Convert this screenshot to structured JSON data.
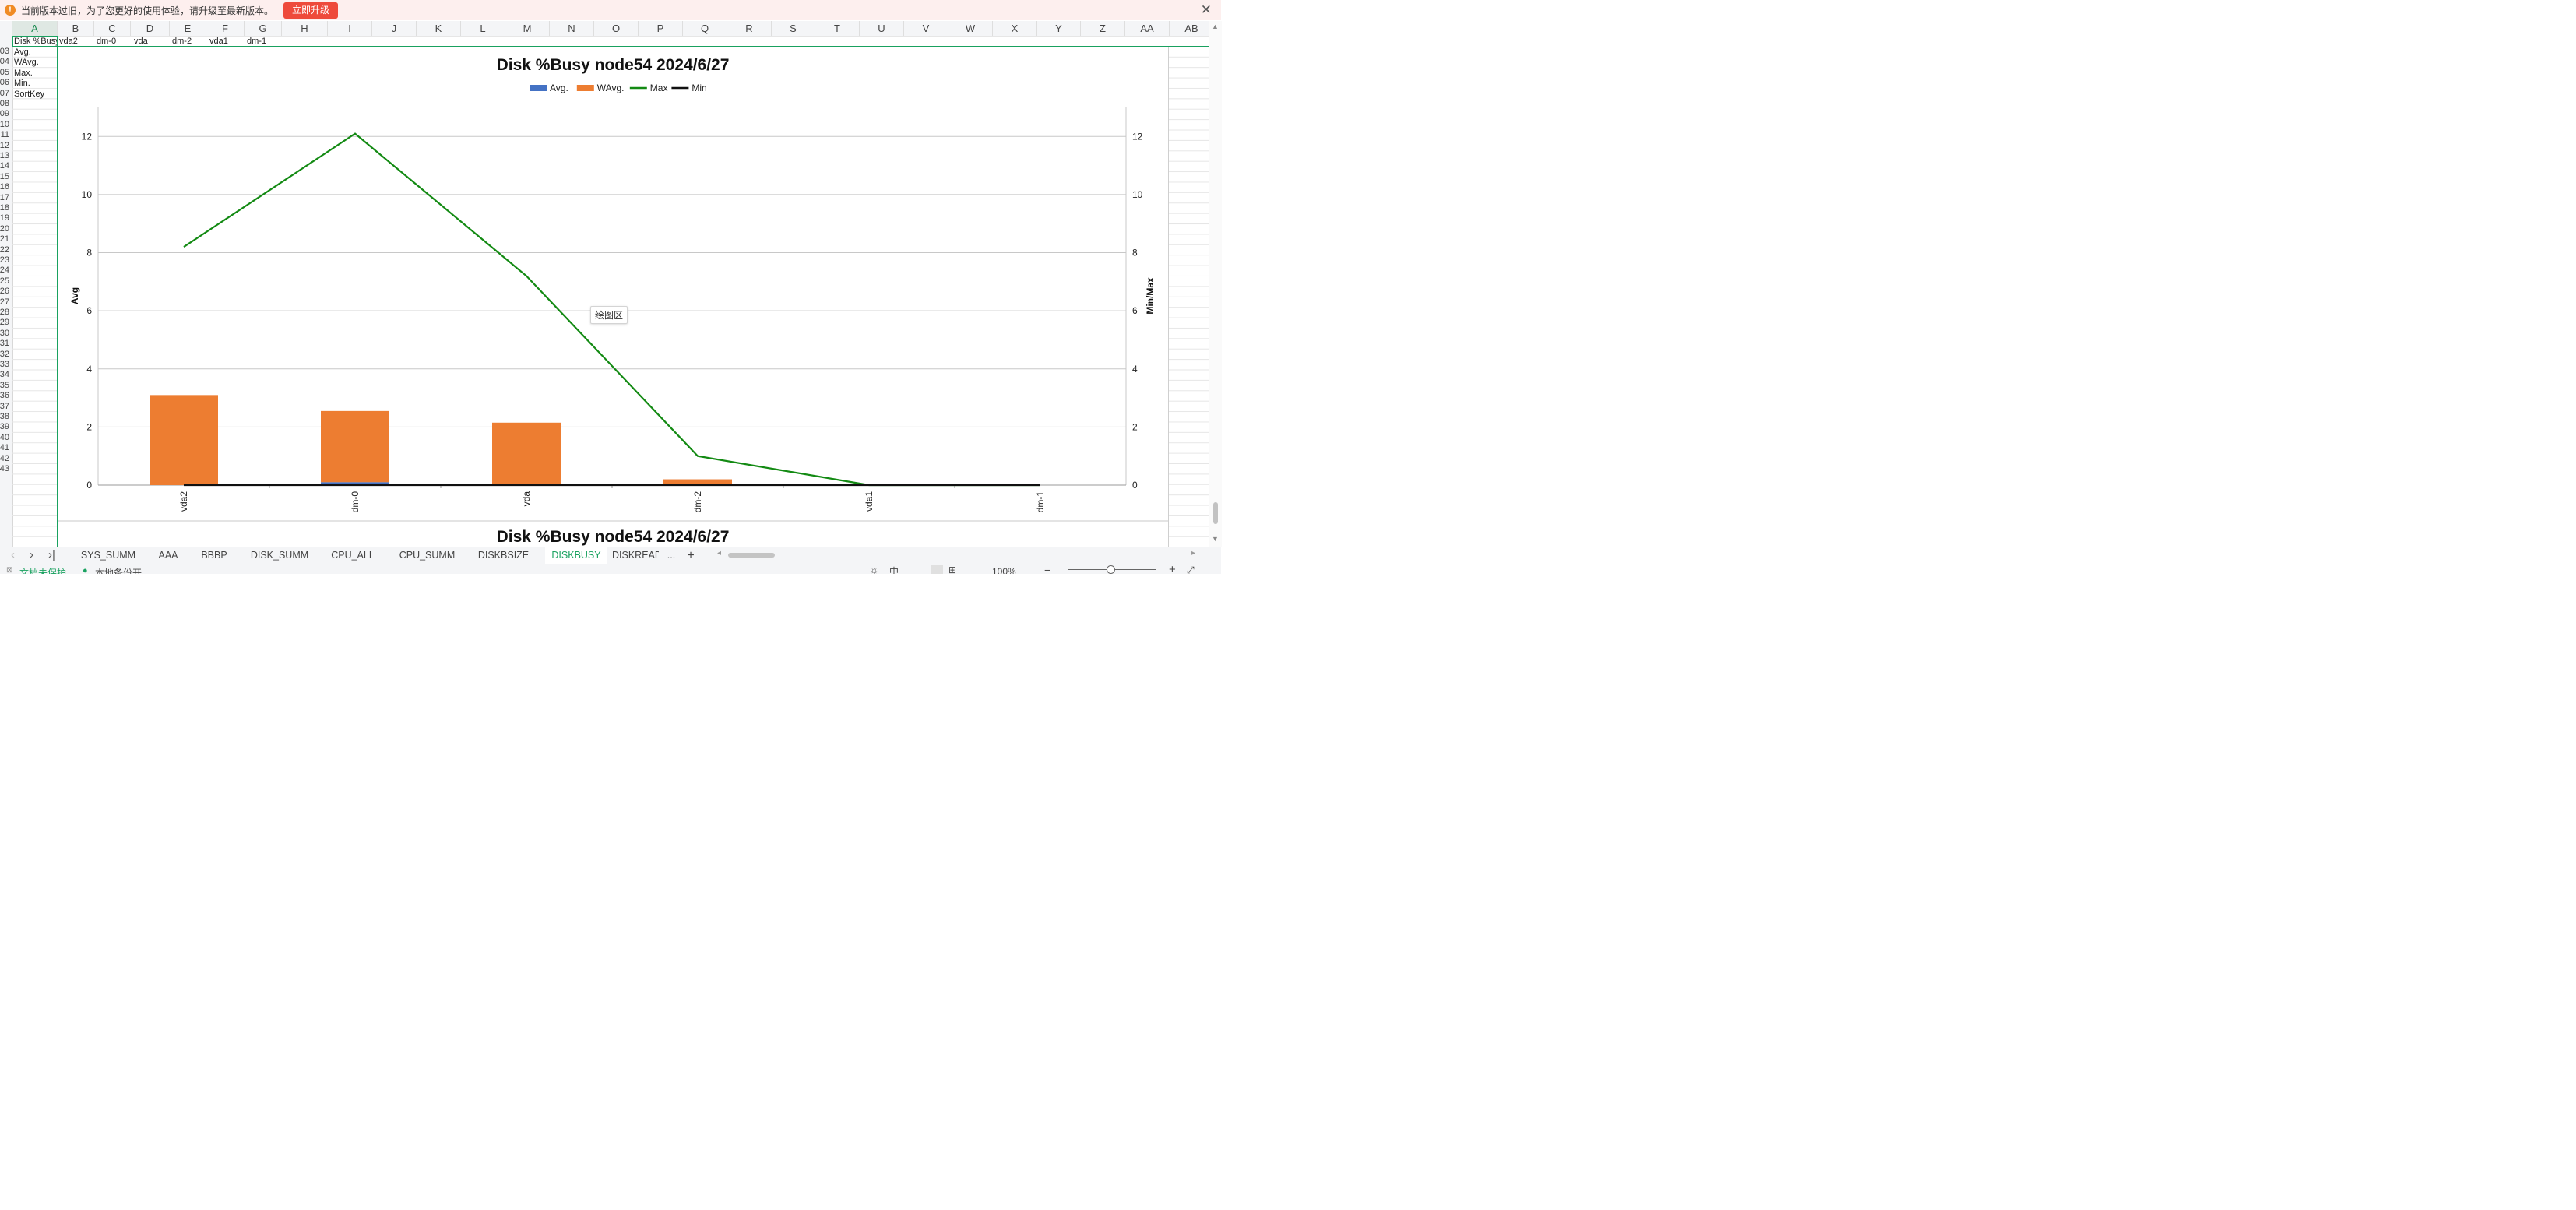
{
  "notice": {
    "message": "当前版本过旧，为了您更好的使用体验，请升级至最新版本。",
    "upgrade_label": "立即升级",
    "warn_glyph": "!",
    "close_glyph": "✕"
  },
  "columns": [
    "A",
    "B",
    "C",
    "D",
    "E",
    "F",
    "G",
    "H",
    "I",
    "J",
    "K",
    "L",
    "M",
    "N",
    "O",
    "P",
    "Q",
    "R",
    "S",
    "T",
    "U",
    "V",
    "W",
    "X",
    "Y",
    "Z",
    "AA",
    "AB"
  ],
  "rows": [
    "03",
    "04",
    "05",
    "06",
    "07",
    "08",
    "09",
    "10",
    "11",
    "12",
    "13",
    "14",
    "15",
    "16",
    "17",
    "18",
    "19",
    "20",
    "21",
    "22",
    "23",
    "24",
    "25",
    "26",
    "27",
    "28",
    "29",
    "30",
    "31",
    "32",
    "33",
    "34",
    "35",
    "36",
    "37",
    "38",
    "39",
    "40",
    "41",
    "42",
    "43"
  ],
  "cells": {
    "row1": [
      "Disk %Busy",
      "vda2",
      "dm-0",
      "vda",
      "dm-2",
      "vda1",
      "dm-1"
    ],
    "col_a": [
      "Avg.",
      "WAvg.",
      "Max.",
      "Min.",
      "SortKey"
    ]
  },
  "chart_data": {
    "type": "bar",
    "title": "Disk %Busy node54  2024/6/27",
    "categories": [
      "vda2",
      "dm-0",
      "vda",
      "dm-2",
      "vda1",
      "dm-1"
    ],
    "series": [
      {
        "name": "Avg.",
        "type": "bar",
        "axis": "left",
        "color": "#4472c4",
        "values": [
          0.0,
          0.1,
          0.0,
          0.0,
          0.0,
          0.0
        ]
      },
      {
        "name": "WAvg.",
        "type": "bar",
        "axis": "left",
        "color": "#ed7d31",
        "values": [
          3.1,
          2.45,
          2.15,
          0.2,
          0.0,
          0.0
        ]
      },
      {
        "name": "Max",
        "type": "line",
        "axis": "right",
        "color": "#138a13",
        "values": [
          8.2,
          12.1,
          7.2,
          1.0,
          0.0,
          0.0
        ]
      },
      {
        "name": "Min",
        "type": "line",
        "axis": "right",
        "color": "#111111",
        "values": [
          0,
          0,
          0,
          0,
          0,
          0
        ]
      }
    ],
    "ylabel": "Avg",
    "y2label": "Min/Max",
    "ylim": [
      0,
      13
    ],
    "y2lim": [
      0,
      13
    ],
    "yticks": [
      0,
      2,
      4,
      6,
      8,
      10,
      12
    ],
    "legend": "top-center",
    "grid": true
  },
  "chart_tooltip": "绘图区",
  "second_chart_title": "Disk %Busy node54  2024/6/27",
  "tabs": [
    "SYS_SUMM",
    "AAA",
    "BBBP",
    "DISK_SUMM",
    "CPU_ALL",
    "CPU_SUMM",
    "DISKBSIZE",
    "DISKBUSY",
    "DISKREAD"
  ],
  "active_tab": "DISKBUSY",
  "tab_more": "...",
  "tab_add": "+",
  "status": {
    "doc_protect": "文档未保护",
    "backup": "本地备份开",
    "zoom": "100%"
  }
}
